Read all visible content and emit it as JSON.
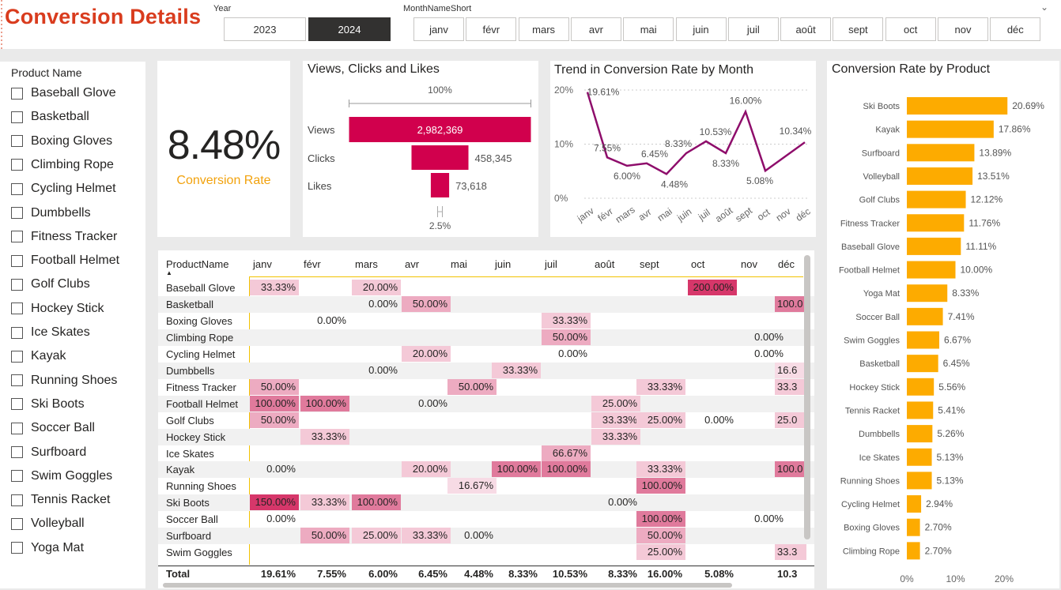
{
  "title": "Conversion Details",
  "year_slicer": {
    "caption": "Year",
    "options": [
      "2023",
      "2024"
    ],
    "selected": "2024"
  },
  "month_slicer": {
    "caption": "MonthNameShort",
    "options": [
      "janv",
      "févr",
      "mars",
      "avr",
      "mai",
      "juin",
      "juil",
      "août",
      "sept",
      "oct",
      "nov",
      "déc"
    ]
  },
  "product_slicer": {
    "caption": "Product Name",
    "items": [
      "Baseball Glove",
      "Basketball",
      "Boxing Gloves",
      "Climbing Rope",
      "Cycling Helmet",
      "Dumbbells",
      "Fitness Tracker",
      "Football Helmet",
      "Golf Clubs",
      "Hockey Stick",
      "Ice Skates",
      "Kayak",
      "Running Shoes",
      "Ski Boots",
      "Soccer Ball",
      "Surfboard",
      "Swim Goggles",
      "Tennis Racket",
      "Volleyball",
      "Yoga Mat"
    ]
  },
  "kpi": {
    "value": "8.48%",
    "label": "Conversion Rate"
  },
  "colors": {
    "accent": "#d93c1e",
    "funnel": "#d1004d",
    "line": "#8e0d6b",
    "bar": "#fdab00",
    "kpi_label": "#f2a20d"
  },
  "funnel": {
    "title": "Views, Clicks and Likes",
    "top_pct": "100%",
    "bottom_pct": "2.5%",
    "stages": [
      {
        "label": "Views",
        "value": 2982369,
        "display": "2,982,369"
      },
      {
        "label": "Clicks",
        "value": 458345,
        "display": "458,345"
      },
      {
        "label": "Likes",
        "value": 73618,
        "display": "73,618"
      }
    ]
  },
  "trend": {
    "title": "Trend in Conversion Rate by Month",
    "y_ticks": [
      "20%",
      "10%",
      "0%"
    ],
    "chart_data": {
      "type": "line",
      "x": [
        "janv",
        "févr",
        "mars",
        "avr",
        "mai",
        "juin",
        "juil",
        "août",
        "sept",
        "oct",
        "nov",
        "déc"
      ],
      "values": [
        19.61,
        7.55,
        6.0,
        6.45,
        4.48,
        8.33,
        10.53,
        8.33,
        16.0,
        5.08,
        null,
        10.34
      ],
      "labels": [
        "19.61%",
        "7.55%",
        "6.00%",
        "6.45%",
        "4.48%",
        "8.33%",
        "10.53%",
        "8.33%",
        "16.00%",
        "5.08%",
        "",
        "10.34%"
      ],
      "ylim": [
        0,
        20
      ]
    }
  },
  "by_product": {
    "title": "Conversion Rate by Product",
    "x_ticks": [
      "0%",
      "10%",
      "20%"
    ],
    "chart_data": {
      "type": "bar",
      "categories": [
        "Ski Boots",
        "Kayak",
        "Surfboard",
        "Volleyball",
        "Golf Clubs",
        "Fitness Tracker",
        "Baseball Glove",
        "Football Helmet",
        "Yoga Mat",
        "Soccer Ball",
        "Swim Goggles",
        "Basketball",
        "Hockey Stick",
        "Tennis Racket",
        "Dumbbells",
        "Ice Skates",
        "Running Shoes",
        "Cycling Helmet",
        "Boxing Gloves",
        "Climbing Rope"
      ],
      "values": [
        20.69,
        17.86,
        13.89,
        13.51,
        12.12,
        11.76,
        11.11,
        10.0,
        8.33,
        7.41,
        6.67,
        6.45,
        5.56,
        5.41,
        5.26,
        5.13,
        5.13,
        2.94,
        2.7,
        2.7
      ],
      "labels": [
        "20.69%",
        "17.86%",
        "13.89%",
        "13.51%",
        "12.12%",
        "11.76%",
        "11.11%",
        "10.00%",
        "8.33%",
        "7.41%",
        "6.67%",
        "6.45%",
        "5.56%",
        "5.41%",
        "5.26%",
        "5.13%",
        "5.13%",
        "2.94%",
        "2.70%",
        "2.70%"
      ],
      "xlim": [
        0,
        22
      ]
    }
  },
  "matrix": {
    "row_header": "ProductName",
    "columns": [
      "janv",
      "févr",
      "mars",
      "avr",
      "mai",
      "juin",
      "juil",
      "août",
      "sept",
      "oct",
      "nov",
      "déc"
    ],
    "rows": [
      {
        "name": "Baseball Glove",
        "cells": [
          "33.33%",
          "",
          "20.00%",
          "",
          "",
          "",
          "",
          "",
          "",
          "200.00%",
          "",
          ""
        ]
      },
      {
        "name": "Basketball",
        "cells": [
          "",
          "",
          "0.00%",
          "50.00%",
          "",
          "",
          "",
          "",
          "",
          "",
          "",
          "100.0"
        ]
      },
      {
        "name": "Boxing Gloves",
        "cells": [
          "",
          "0.00%",
          "",
          "",
          "",
          "",
          "33.33%",
          "",
          "",
          "",
          "",
          ""
        ]
      },
      {
        "name": "Climbing Rope",
        "cells": [
          "",
          "",
          "",
          "",
          "",
          "",
          "50.00%",
          "",
          "",
          "",
          "0.00%",
          ""
        ]
      },
      {
        "name": "Cycling Helmet",
        "cells": [
          "",
          "",
          "",
          "20.00%",
          "",
          "",
          "0.00%",
          "",
          "",
          "",
          "0.00%",
          ""
        ]
      },
      {
        "name": "Dumbbells",
        "cells": [
          "",
          "",
          "0.00%",
          "",
          "",
          "33.33%",
          "",
          "",
          "",
          "",
          "",
          "16.6"
        ]
      },
      {
        "name": "Fitness Tracker",
        "cells": [
          "50.00%",
          "",
          "",
          "",
          "50.00%",
          "",
          "",
          "",
          "33.33%",
          "",
          "",
          "33.3"
        ]
      },
      {
        "name": "Football Helmet",
        "cells": [
          "100.00%",
          "100.00%",
          "",
          "0.00%",
          "",
          "",
          "",
          "25.00%",
          "",
          "",
          "",
          ""
        ]
      },
      {
        "name": "Golf Clubs",
        "cells": [
          "50.00%",
          "",
          "",
          "",
          "",
          "",
          "",
          "33.33%",
          "25.00%",
          "0.00%",
          "",
          "25.0"
        ]
      },
      {
        "name": "Hockey Stick",
        "cells": [
          "",
          "33.33%",
          "",
          "",
          "",
          "",
          "",
          "33.33%",
          "",
          "",
          "",
          ""
        ]
      },
      {
        "name": "Ice Skates",
        "cells": [
          "",
          "",
          "",
          "",
          "",
          "",
          "66.67%",
          "",
          "",
          "",
          "",
          ""
        ]
      },
      {
        "name": "Kayak",
        "cells": [
          "0.00%",
          "",
          "",
          "20.00%",
          "",
          "100.00%",
          "100.00%",
          "",
          "33.33%",
          "",
          "",
          "100.0"
        ]
      },
      {
        "name": "Running Shoes",
        "cells": [
          "",
          "",
          "",
          "",
          "16.67%",
          "",
          "",
          "",
          "100.00%",
          "",
          "",
          ""
        ]
      },
      {
        "name": "Ski Boots",
        "cells": [
          "150.00%",
          "33.33%",
          "100.00%",
          "",
          "",
          "",
          "",
          "0.00%",
          "",
          "",
          "",
          ""
        ]
      },
      {
        "name": "Soccer Ball",
        "cells": [
          "0.00%",
          "",
          "",
          "",
          "",
          "",
          "",
          "",
          "100.00%",
          "",
          "0.00%",
          ""
        ]
      },
      {
        "name": "Surfboard",
        "cells": [
          "",
          "50.00%",
          "25.00%",
          "33.33%",
          "0.00%",
          "",
          "",
          "",
          "50.00%",
          "",
          "",
          ""
        ]
      },
      {
        "name": "Swim Goggles",
        "cells": [
          "",
          "",
          "",
          "",
          "",
          "",
          "",
          "",
          "25.00%",
          "",
          "",
          "33.3"
        ]
      }
    ],
    "total_label": "Total",
    "totals": [
      "19.61%",
      "7.55%",
      "6.00%",
      "6.45%",
      "4.48%",
      "8.33%",
      "10.53%",
      "8.33%",
      "16.00%",
      "5.08%",
      "",
      "10.3"
    ]
  }
}
